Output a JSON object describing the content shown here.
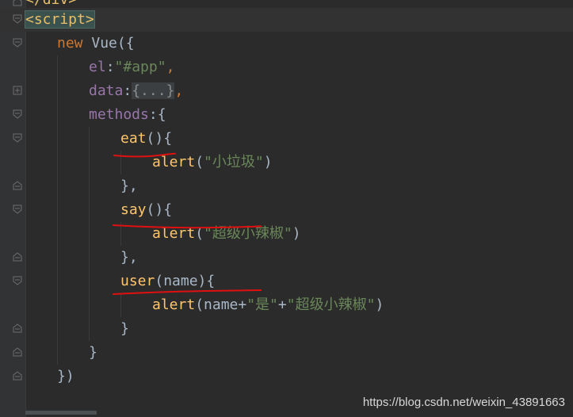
{
  "editor": {
    "lines": [
      {
        "tokens": [
          {
            "text": "</",
            "cls": "k-tag"
          },
          {
            "text": "div",
            "cls": "k-tag"
          },
          {
            "text": ">",
            "cls": "k-tag"
          }
        ]
      },
      {
        "tokens": [
          {
            "text": "<script>",
            "cls": "k-tagwrap"
          }
        ]
      },
      {
        "tokens": [
          {
            "text": "new ",
            "cls": "k-kw"
          },
          {
            "text": "Vue",
            "cls": "k-plain"
          },
          {
            "text": "({",
            "cls": "k-plain"
          }
        ]
      },
      {
        "tokens": [
          {
            "text": "el",
            "cls": "k-prop"
          },
          {
            "text": ":",
            "cls": "k-plain"
          },
          {
            "text": "\"#app\"",
            "cls": "k-str"
          },
          {
            "text": ",",
            "cls": "k-kw"
          }
        ]
      },
      {
        "tokens": [
          {
            "text": "data",
            "cls": "k-prop"
          },
          {
            "text": ":",
            "cls": "k-plain"
          },
          {
            "text": "{...}",
            "cls": "k-folded"
          },
          {
            "text": ",",
            "cls": "k-kw"
          }
        ]
      },
      {
        "tokens": [
          {
            "text": "methods",
            "cls": "k-prop"
          },
          {
            "text": ":{",
            "cls": "k-plain"
          }
        ]
      },
      {
        "tokens": [
          {
            "text": "eat",
            "cls": "k-fn"
          },
          {
            "text": "(){",
            "cls": "k-plain"
          }
        ]
      },
      {
        "tokens": [
          {
            "text": "alert",
            "cls": "k-fn"
          },
          {
            "text": "(",
            "cls": "k-plain"
          },
          {
            "text": "\"小垃圾\"",
            "cls": "k-str"
          },
          {
            "text": ")",
            "cls": "k-plain"
          }
        ]
      },
      {
        "tokens": [
          {
            "text": "},",
            "cls": "k-plain"
          }
        ]
      },
      {
        "tokens": [
          {
            "text": "say",
            "cls": "k-fn"
          },
          {
            "text": "(){",
            "cls": "k-plain"
          }
        ]
      },
      {
        "tokens": [
          {
            "text": "alert",
            "cls": "k-fn"
          },
          {
            "text": "(",
            "cls": "k-plain"
          },
          {
            "text": "\"超级小辣椒\"",
            "cls": "k-str"
          },
          {
            "text": ")",
            "cls": "k-plain"
          }
        ]
      },
      {
        "tokens": [
          {
            "text": "},",
            "cls": "k-plain"
          }
        ]
      },
      {
        "tokens": [
          {
            "text": "user",
            "cls": "k-fn"
          },
          {
            "text": "(name){",
            "cls": "k-plain"
          }
        ]
      },
      {
        "tokens": [
          {
            "text": "alert",
            "cls": "k-fn"
          },
          {
            "text": "(name+",
            "cls": "k-plain"
          },
          {
            "text": "\"是\"",
            "cls": "k-str"
          },
          {
            "text": "+",
            "cls": "k-plain"
          },
          {
            "text": "\"超级小辣椒\"",
            "cls": "k-str"
          },
          {
            "text": ")",
            "cls": "k-plain"
          }
        ]
      },
      {
        "tokens": [
          {
            "text": "}",
            "cls": "k-plain"
          }
        ]
      },
      {
        "tokens": [
          {
            "text": "}",
            "cls": "k-plain"
          }
        ]
      },
      {
        "tokens": [
          {
            "text": "})",
            "cls": "k-plain"
          }
        ]
      }
    ]
  },
  "watermark": "https://blog.csdn.net/weixin_43891663",
  "colors": {
    "background": "#2b2b2b",
    "gutter": "#313335",
    "keyword": "#cc7832",
    "function": "#ffc66d",
    "property": "#9876aa",
    "string": "#6a8759",
    "tag": "#e8bf6a",
    "annotation_red": "#e01010"
  }
}
